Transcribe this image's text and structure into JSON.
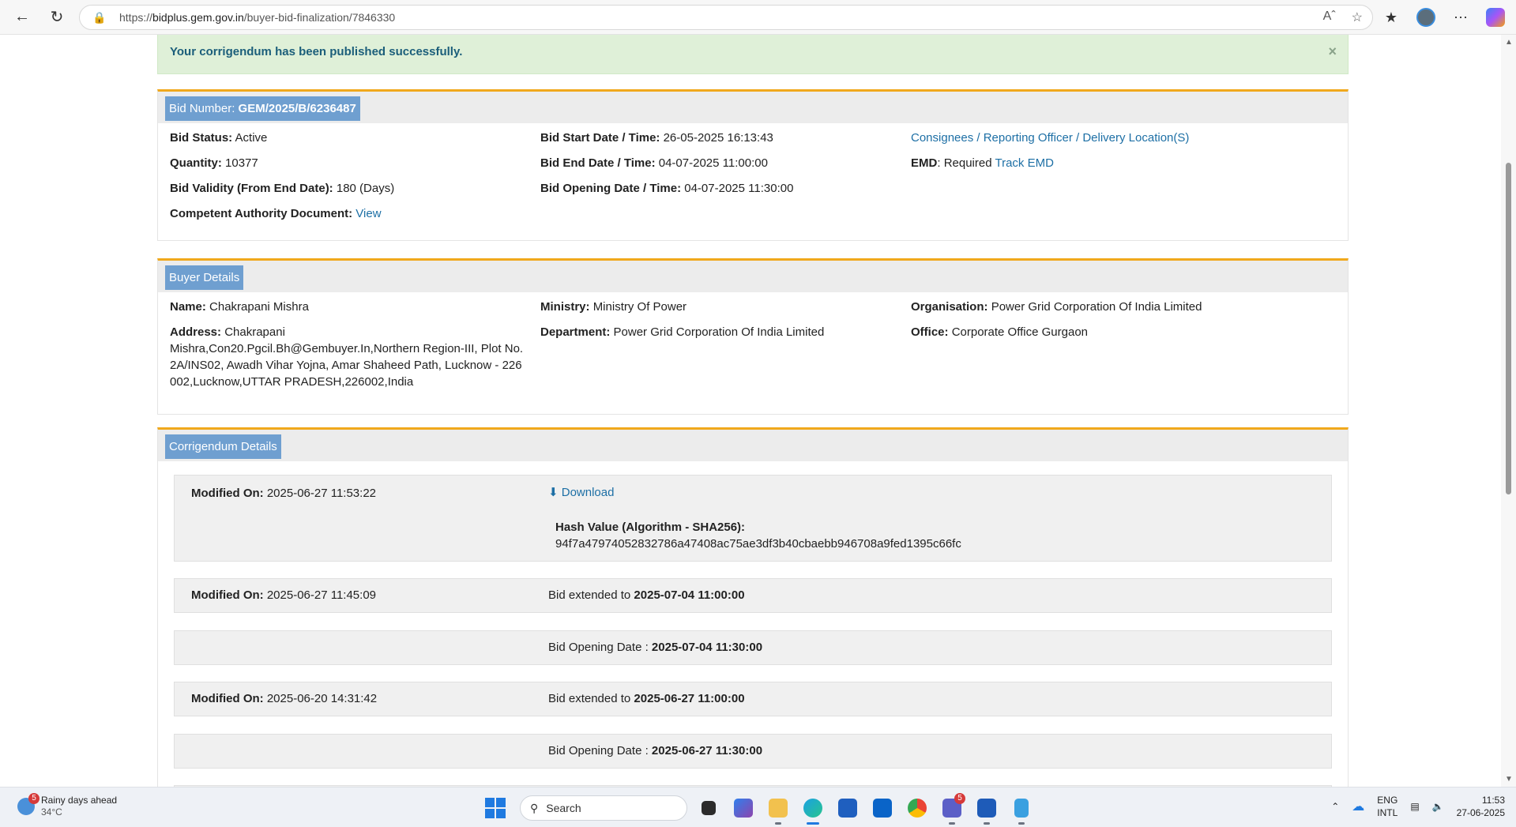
{
  "browser": {
    "url_prefix": "https://",
    "url_domain": "bidplus.gem.gov.in",
    "url_path": "/buyer-bid-finalization/7846330"
  },
  "alert": {
    "message": "Your corrigendum has been published successfully.",
    "close": "×"
  },
  "bid": {
    "label": "Bid Number: ",
    "number": "GEM/2025/B/6236487",
    "status_label": "Bid Status:",
    "status": "Active",
    "quantity_label": "Quantity:",
    "quantity": "10377",
    "validity_label": "Bid Validity (From End Date):",
    "validity": "180 (Days)",
    "authority_label": "Competent Authority Document:",
    "authority_link": "View",
    "start_label": "Bid Start Date / Time:",
    "start": "26-05-2025 16:13:43",
    "end_label": "Bid End Date / Time:",
    "end": "04-07-2025 11:00:00",
    "opening_label": "Bid Opening Date / Time:",
    "opening": "04-07-2025 11:30:00",
    "consignees_link": "Consignees / Reporting Officer / Delivery Location(S)",
    "emd_label": "EMD",
    "emd": "Required",
    "track_emd": "Track EMD"
  },
  "buyer": {
    "title": "Buyer Details",
    "name_label": "Name:",
    "name": "Chakrapani Mishra",
    "address_label": "Address:",
    "address_1": "Chakrapani",
    "address_2": "Mishra,Con20.Pgcil.Bh@Gembuyer.In,Northern Region-III, Plot No.",
    "address_3": "2A/INS02, Awadh Vihar Yojna, Amar Shaheed Path, Lucknow - 226",
    "address_4": "002,Lucknow,UTTAR PRADESH,226002,India",
    "ministry_label": "Ministry:",
    "ministry": "Ministry Of Power",
    "department_label": "Department:",
    "department": "Power Grid Corporation Of India Limited",
    "organisation_label": "Organisation:",
    "organisation": "Power Grid Corporation Of India Limited",
    "office_label": "Office:",
    "office": "Corporate Office Gurgaon"
  },
  "corrigendum": {
    "title": "Corrigendum Details",
    "modified_label": "Modified On:",
    "download": "Download",
    "hash_label": "Hash Value (Algorithm - SHA256):",
    "entries": [
      {
        "modified": "2025-06-27 11:53:22",
        "hash": "94f7a47974052832786a47408ac75ae3df3b40cbaebb946708a9fed1395c66fc"
      },
      {
        "modified": "2025-06-27 11:45:09",
        "text": "Bid extended to",
        "value": "2025-07-04 11:00:00"
      },
      {
        "text": "Bid Opening Date :",
        "value": "2025-07-04 11:30:00"
      },
      {
        "modified": "2025-06-20 14:31:42",
        "text": "Bid extended to",
        "value": "2025-06-27 11:00:00"
      },
      {
        "text": "Bid Opening Date :",
        "value": "2025-06-27 11:30:00"
      }
    ]
  },
  "taskbar": {
    "weather_title": "Rainy days ahead",
    "weather_temp": "34°C",
    "weather_badge": "5",
    "search": "Search",
    "teams_badge": "5",
    "lang_1": "ENG",
    "lang_2": "INTL",
    "time": "11:53",
    "date": "27-06-2025"
  }
}
